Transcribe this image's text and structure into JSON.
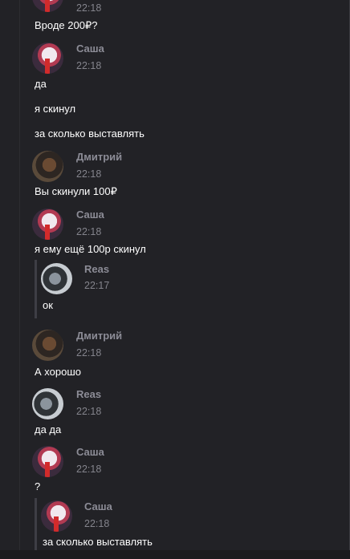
{
  "messages": [
    {
      "author": "",
      "time": "22:18",
      "text": "Вроде 200₽?"
    },
    {
      "author": "Саша",
      "time": "22:18",
      "lines": [
        "да",
        "я скинул",
        "за сколько выставлять"
      ]
    },
    {
      "author": "Дмитрий",
      "time": "22:18",
      "text": "Вы скинули 100₽"
    },
    {
      "author": "Саша",
      "time": "22:18",
      "text": "я ему ещё 100р скинул"
    },
    {
      "author": "Reas",
      "time": "22:17",
      "text": "ок"
    },
    {
      "author": "Дмитрий",
      "time": "22:18",
      "text": "А хорошо"
    },
    {
      "author": "Reas",
      "time": "22:18",
      "text": "да да"
    },
    {
      "author": "Саша",
      "time": "22:18",
      "text": "?"
    },
    {
      "author": "Саша",
      "time": "22:18",
      "text": "за сколько выставлять"
    }
  ],
  "avatars": {
    "sasha": "sasha-avatar",
    "dmitry": "dmitry-avatar",
    "reas": "reas-avatar"
  },
  "colors": {
    "background": "#222226",
    "name": "#8c8c96",
    "time": "#84848c",
    "text": "#ffffff",
    "quote_bar": "#3e3e45"
  }
}
